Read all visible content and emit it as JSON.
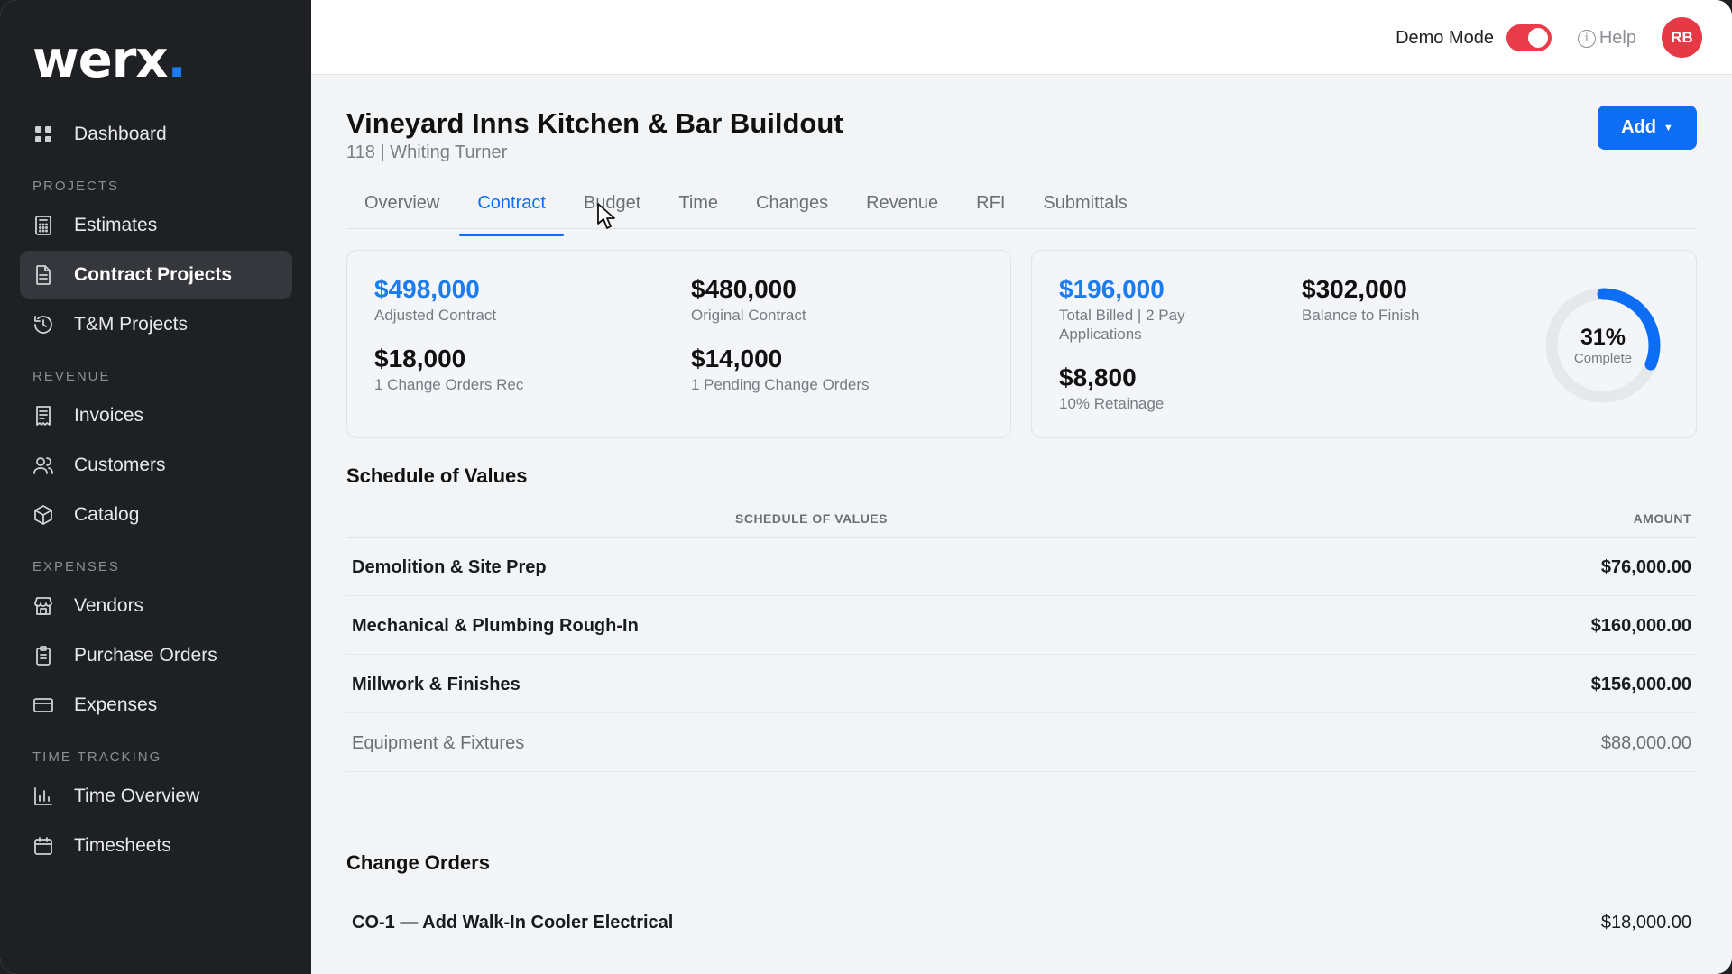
{
  "app": {
    "logo_text": "werx",
    "logo_dot": "."
  },
  "sidebar": {
    "items": [
      {
        "type": "item",
        "label": "Dashboard",
        "icon": "grid-icon"
      },
      {
        "type": "section",
        "label": "PROJECTS"
      },
      {
        "type": "item",
        "label": "Estimates",
        "icon": "calculator-icon"
      },
      {
        "type": "item",
        "label": "Contract Projects",
        "icon": "document-icon",
        "active": true
      },
      {
        "type": "item",
        "label": "T&M Projects",
        "icon": "history-icon"
      },
      {
        "type": "section",
        "label": "REVENUE"
      },
      {
        "type": "item",
        "label": "Invoices",
        "icon": "receipt-icon"
      },
      {
        "type": "item",
        "label": "Customers",
        "icon": "users-icon"
      },
      {
        "type": "item",
        "label": "Catalog",
        "icon": "box-icon"
      },
      {
        "type": "section",
        "label": "EXPENSES"
      },
      {
        "type": "item",
        "label": "Vendors",
        "icon": "store-icon"
      },
      {
        "type": "item",
        "label": "Purchase Orders",
        "icon": "clipboard-icon"
      },
      {
        "type": "item",
        "label": "Expenses",
        "icon": "credit-card-icon"
      },
      {
        "type": "section",
        "label": "TIME TRACKING"
      },
      {
        "type": "item",
        "label": "Time Overview",
        "icon": "bar-chart-icon"
      },
      {
        "type": "item",
        "label": "Timesheets",
        "icon": "calendar-icon"
      }
    ]
  },
  "topbar": {
    "demo_mode_label": "Demo Mode",
    "demo_mode_on": true,
    "help_label": "Help",
    "avatar_initials": "RB"
  },
  "project": {
    "title": "Vineyard Inns Kitchen & Bar Buildout",
    "subtitle": "118 | Whiting Turner",
    "add_label": "Add"
  },
  "tabs": [
    "Overview",
    "Contract",
    "Budget",
    "Time",
    "Changes",
    "Revenue",
    "RFI",
    "Submittals"
  ],
  "active_tab": "Contract",
  "summary_left": {
    "adjusted_contract": {
      "value": "$498,000",
      "label": "Adjusted Contract"
    },
    "original_contract": {
      "value": "$480,000",
      "label": "Original Contract"
    },
    "change_orders_rec": {
      "value": "$18,000",
      "label": "1 Change Orders Rec"
    },
    "pending_change_orders": {
      "value": "$14,000",
      "label": "1 Pending Change Orders"
    }
  },
  "summary_right": {
    "total_billed": {
      "value": "$196,000",
      "label": "Total Billed | 2 Pay Applications"
    },
    "balance_to_finish": {
      "value": "$302,000",
      "label": "Balance to Finish"
    },
    "retainage": {
      "value": "$8,800",
      "label": "10% Retainage"
    },
    "completion": {
      "percent_text": "31%",
      "label": "Complete",
      "fraction": 0.31
    }
  },
  "schedule_of_values": {
    "section_title": "Schedule of Values",
    "col_item": "SCHEDULE OF VALUES",
    "col_amount": "AMOUNT",
    "rows": [
      {
        "name": "Demolition & Site Prep",
        "amount": "$76,000.00"
      },
      {
        "name": "Mechanical & Plumbing Rough-In",
        "amount": "$160,000.00"
      },
      {
        "name": "Millwork & Finishes",
        "amount": "$156,000.00"
      },
      {
        "name": "Equipment & Fixtures",
        "amount": "$88,000.00"
      }
    ]
  },
  "change_orders": {
    "section_title": "Change Orders",
    "rows": [
      {
        "name": "CO-1 — Add Walk-In Cooler Electrical",
        "amount": "$18,000.00"
      }
    ]
  },
  "colors": {
    "accent": "#0d6ef5",
    "toggle_on": "#ea3b4a",
    "avatar": "#e63946"
  }
}
